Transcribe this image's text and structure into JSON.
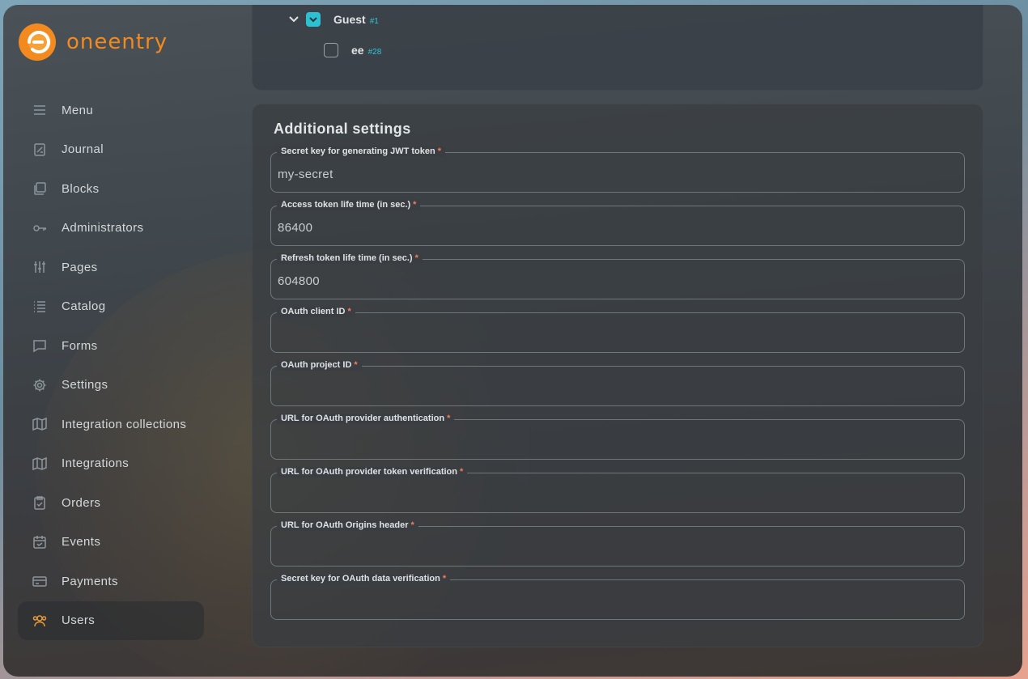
{
  "brand": {
    "name_part1": "one",
    "name_part2": "entry",
    "color": "#f28a1f"
  },
  "sidebar": {
    "items": [
      {
        "label": "Menu",
        "icon": "menu-icon",
        "active": false
      },
      {
        "label": "Journal",
        "icon": "journal-icon",
        "active": false
      },
      {
        "label": "Blocks",
        "icon": "blocks-icon",
        "active": false
      },
      {
        "label": "Administrators",
        "icon": "key-icon",
        "active": false
      },
      {
        "label": "Pages",
        "icon": "sliders-icon",
        "active": false
      },
      {
        "label": "Catalog",
        "icon": "list-icon",
        "active": false
      },
      {
        "label": "Forms",
        "icon": "chat-icon",
        "active": false
      },
      {
        "label": "Settings",
        "icon": "gear-icon",
        "active": false
      },
      {
        "label": "Integration collections",
        "icon": "map-icon",
        "active": false
      },
      {
        "label": "Integrations",
        "icon": "map-icon",
        "active": false
      },
      {
        "label": "Orders",
        "icon": "clipboard-check-icon",
        "active": false
      },
      {
        "label": "Events",
        "icon": "calendar-icon",
        "active": false
      },
      {
        "label": "Payments",
        "icon": "card-icon",
        "active": false
      },
      {
        "label": "Users",
        "icon": "users-icon",
        "active": true
      }
    ]
  },
  "tree": [
    {
      "label": "Guest",
      "id": "#1",
      "checked": true,
      "expanded": true
    },
    {
      "label": "ee",
      "id": "#28",
      "checked": false
    }
  ],
  "additional_settings": {
    "title": "Additional settings",
    "fields": [
      {
        "label": "Secret key for generating JWT token",
        "value": "my-secret",
        "required": true
      },
      {
        "label": "Access token life time (in sec.)",
        "value": "86400",
        "required": true
      },
      {
        "label": "Refresh token life time (in sec.)",
        "value": "604800",
        "required": true
      },
      {
        "label": "OAuth client ID",
        "value": "",
        "required": true
      },
      {
        "label": "OAuth project ID",
        "value": "",
        "required": true
      },
      {
        "label": "URL for OAuth provider authentication",
        "value": "",
        "required": true
      },
      {
        "label": "URL for OAuth provider token verification",
        "value": "",
        "required": true
      },
      {
        "label": "URL for OAuth Origins header",
        "value": "",
        "required": true
      },
      {
        "label": "Secret key for OAuth data verification",
        "value": "",
        "required": true
      }
    ],
    "required_mark": "*"
  },
  "colors": {
    "accent": "#2cc1d2",
    "required": "#f47b5b",
    "active_icon": "#e59a3a"
  }
}
